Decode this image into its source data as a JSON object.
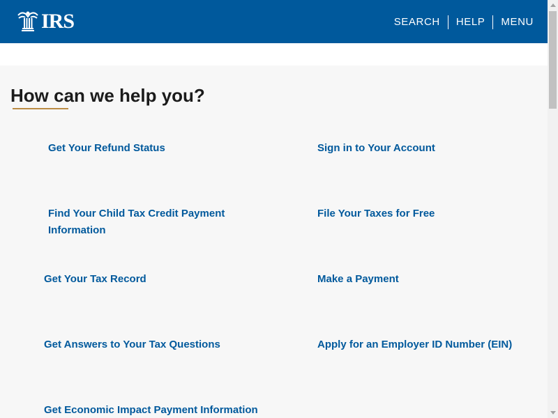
{
  "header": {
    "logo_text": "IRS",
    "nav": [
      {
        "label": "SEARCH"
      },
      {
        "label": "HELP"
      },
      {
        "label": "MENU"
      }
    ]
  },
  "main": {
    "title": "How can we help you?",
    "links": [
      {
        "label": "Get Your Refund Status"
      },
      {
        "label": "Sign in to Your Account"
      },
      {
        "label": "Find Your Child Tax Credit Payment Information"
      },
      {
        "label": "File Your Taxes for Free"
      },
      {
        "label": "Get Your Tax Record"
      },
      {
        "label": "Make a Payment"
      },
      {
        "label": "Get Answers to Your Tax Questions"
      },
      {
        "label": "Apply for an Employer ID Number (EIN)"
      },
      {
        "label": "Get Economic Impact Payment Information"
      }
    ]
  },
  "colors": {
    "header_bg": "#00599c",
    "link": "#00599c",
    "accent_underline": "#bb8c44",
    "content_bg": "#f7f7f7"
  },
  "icons": {
    "logo": "irs-eagle-logo-icon"
  }
}
